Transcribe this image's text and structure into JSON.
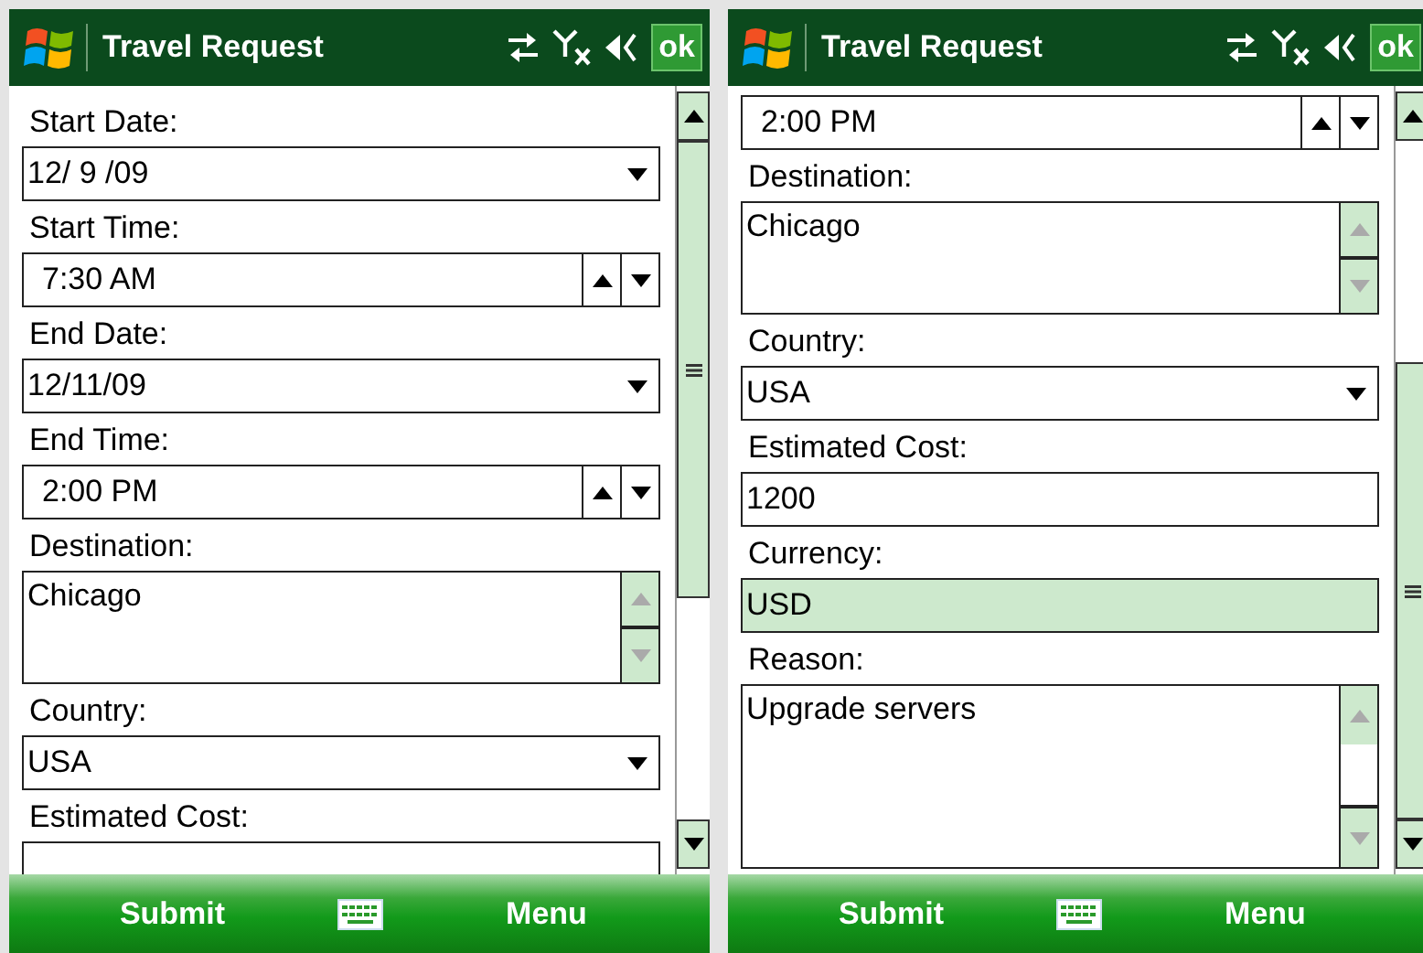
{
  "screens": [
    {
      "title": "Travel Request",
      "ok": "ok",
      "scrolled_to_end": false,
      "items": [
        {
          "label": "Start Date:",
          "kind": "dropdown",
          "value": "12/ 9 /09"
        },
        {
          "label": "Start Time:",
          "kind": "spinner",
          "value": "7:30 AM"
        },
        {
          "label": "End Date:",
          "kind": "dropdown",
          "value": "12/11/09"
        },
        {
          "label": "End Time:",
          "kind": "spinner",
          "value": "2:00 PM"
        },
        {
          "label": "Destination:",
          "kind": "multiline",
          "value": "Chicago"
        },
        {
          "label": "Country:",
          "kind": "dropdown",
          "value": "USA"
        },
        {
          "label": "Estimated Cost:",
          "kind": "text"
        }
      ],
      "softkeys": {
        "left": "Submit",
        "right": "Menu"
      }
    },
    {
      "title": "Travel Request",
      "ok": "ok",
      "scrolled_to_end": true,
      "items": [
        {
          "kind": "spinner",
          "value": "2:00 PM"
        },
        {
          "label": "Destination:",
          "kind": "multiline",
          "value": "Chicago"
        },
        {
          "label": "Country:",
          "kind": "dropdown",
          "value": "USA"
        },
        {
          "label": "Estimated Cost:",
          "kind": "text",
          "value": "1200"
        },
        {
          "label": "Currency:",
          "kind": "readonly",
          "value": "USD"
        },
        {
          "label": "Reason:",
          "kind": "multiline",
          "value": "Upgrade servers"
        }
      ],
      "softkeys": {
        "left": "Submit",
        "right": "Menu"
      }
    }
  ]
}
